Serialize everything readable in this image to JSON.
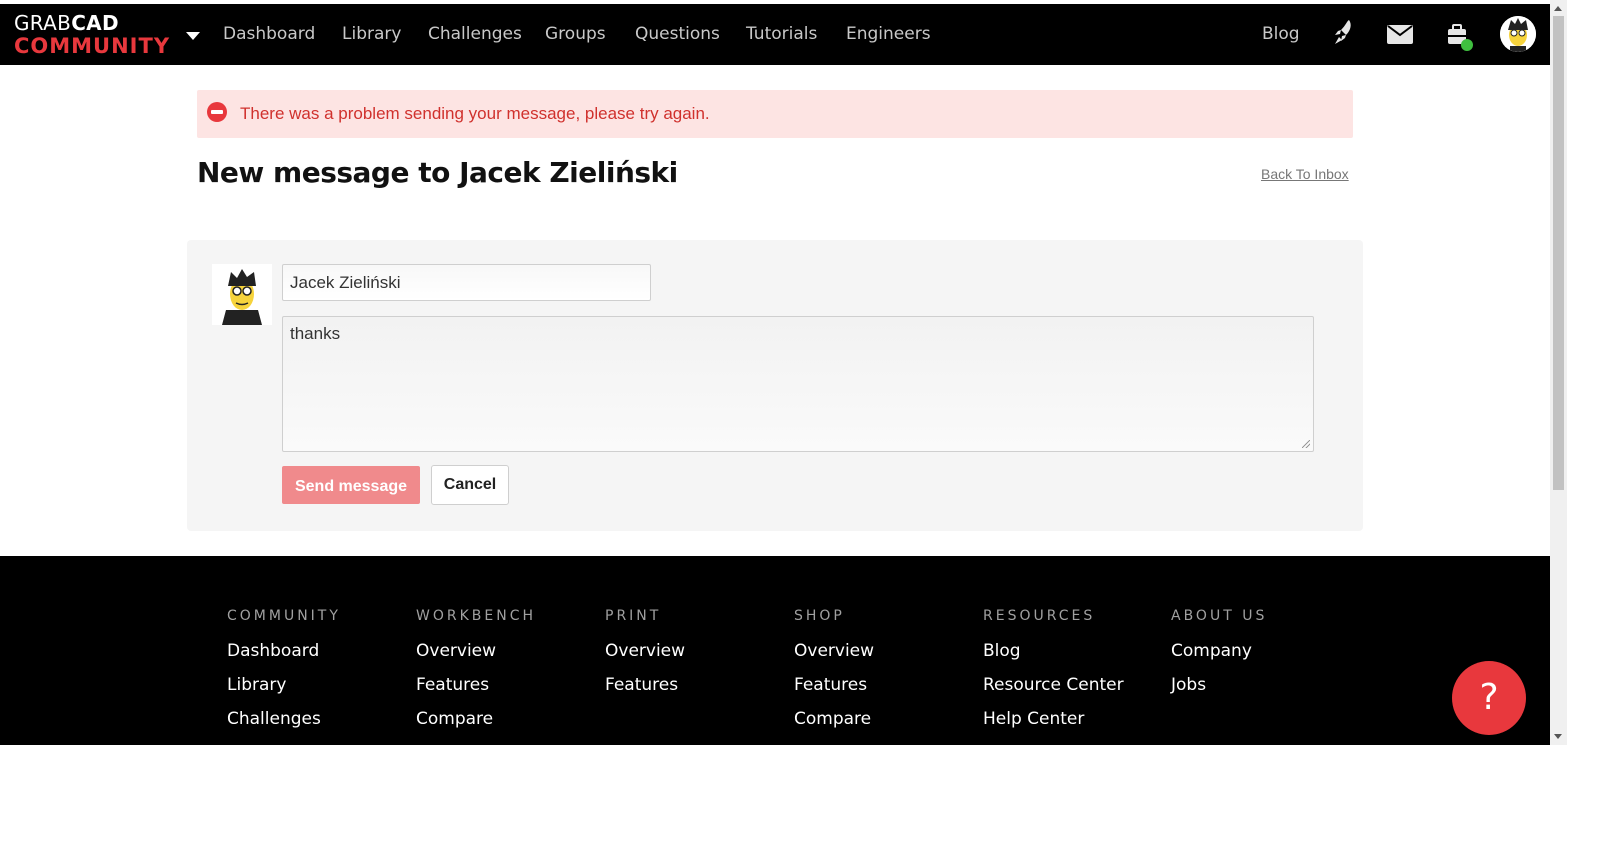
{
  "brand": {
    "line1_light": "GRAB",
    "line1_bold": "CAD",
    "line2": "COMMUNITY"
  },
  "nav": {
    "items": [
      "Dashboard",
      "Library",
      "Challenges",
      "Groups",
      "Questions",
      "Tutorials",
      "Engineers"
    ],
    "blog": "Blog",
    "icons": [
      "rocket-icon",
      "mail-icon",
      "briefcase-icon",
      "avatar"
    ]
  },
  "alert": {
    "text": "There was a problem sending your message, please try again."
  },
  "compose": {
    "title": "New message to Jacek Zieliński",
    "back_link": "Back To Inbox",
    "to_value": "Jacek Zieliński",
    "body_value": "thanks",
    "send_label": "Send message",
    "cancel_label": "Cancel"
  },
  "footer": {
    "columns": [
      {
        "heading": "COMMUNITY",
        "links": [
          "Dashboard",
          "Library",
          "Challenges"
        ]
      },
      {
        "heading": "WORKBENCH",
        "links": [
          "Overview",
          "Features",
          "Compare"
        ]
      },
      {
        "heading": "PRINT",
        "links": [
          "Overview",
          "Features"
        ]
      },
      {
        "heading": "SHOP",
        "links": [
          "Overview",
          "Features",
          "Compare"
        ]
      },
      {
        "heading": "RESOURCES",
        "links": [
          "Blog",
          "Resource Center",
          "Help Center"
        ]
      },
      {
        "heading": "ABOUT US",
        "links": [
          "Company",
          "Jobs"
        ]
      }
    ]
  },
  "help": {
    "label": "?"
  },
  "colors": {
    "accent": "#e8383d",
    "alert_bg": "#fde4e3",
    "send_disabled": "#f08a8c",
    "nav_bg": "#000000"
  }
}
